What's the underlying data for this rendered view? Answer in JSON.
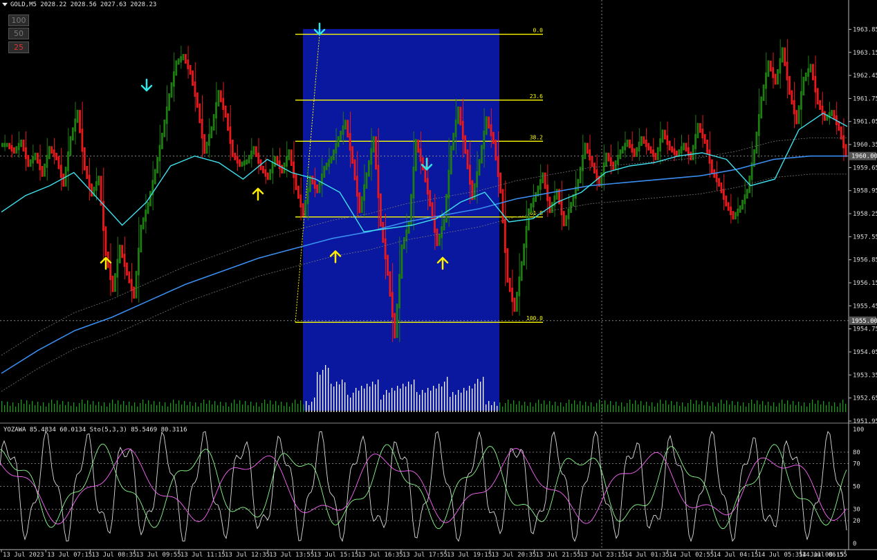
{
  "header": {
    "symbol_label": "GOLD,M5  2028.22 2028.56 2027.63 2028.23"
  },
  "zoom_buttons": [
    {
      "label": "100",
      "active": false
    },
    {
      "label": "50",
      "active": false
    },
    {
      "label": "25",
      "active": true
    }
  ],
  "indicator": {
    "label": "YOZAWA 85.4834 60.0134  Sto(5,3,3) 85.5469 80.3116"
  },
  "colors": {
    "bull": "#1e7d10",
    "bear": "#e8181c",
    "fast_ma": "#3ee0ee",
    "slow_ma": "#3a8ef0",
    "fib": "#ffff00",
    "highlight": "#0a18a0",
    "arrow_up": "#ffee00",
    "arrow_down": "#30e6e6"
  },
  "chart_data": {
    "type": "candlestick",
    "price_axis": {
      "range": [
        1951.95,
        1964.3
      ],
      "ticks": [
        "1963.85",
        "1963.15",
        "1962.45",
        "1961.75",
        "1961.05",
        "1960.35",
        "1959.65",
        "1958.95",
        "1958.25",
        "1957.55",
        "1956.85",
        "1956.15",
        "1955.45",
        "1954.75",
        "1954.05",
        "1953.35",
        "1952.65",
        "1951.95"
      ],
      "markers": [
        "1960.00",
        "1955.00"
      ]
    },
    "time_axis": {
      "ticks": [
        "13 Jul 2023",
        "13 Jul 07:15",
        "13 Jul 08:35",
        "13 Jul 09:55",
        "13 Jul 11:15",
        "13 Jul 12:35",
        "13 Jul 13:55",
        "13 Jul 15:15",
        "13 Jul 16:35",
        "13 Jul 17:55",
        "13 Jul 19:15",
        "13 Jul 20:35",
        "13 Jul 21:55",
        "13 Jul 23:15",
        "14 Jul 01:35",
        "14 Jul 02:55",
        "14 Jul 04:15",
        "14 Jul 05:35",
        "14 Jul 06:55",
        "14 Jul 08:15"
      ]
    },
    "fibonacci": [
      {
        "label": "0.0",
        "price": 1963.7
      },
      {
        "label": "23.6",
        "price": 1961.7
      },
      {
        "label": "38.2",
        "price": 1960.45
      },
      {
        "label": "61.8",
        "price": 1958.15
      },
      {
        "label": "100.0",
        "price": 1954.95
      }
    ],
    "candle_closes": [
      1960.4,
      1960.2,
      1960.5,
      1959.8,
      1960.1,
      1959.5,
      1960.3,
      1960.0,
      1959.2,
      1960.6,
      1961.4,
      1959.7,
      1958.9,
      1959.4,
      1957.1,
      1956.0,
      1957.3,
      1956.5,
      1955.8,
      1957.9,
      1958.6,
      1959.6,
      1960.7,
      1961.9,
      1962.9,
      1963.1,
      1962.6,
      1961.6,
      1960.2,
      1960.9,
      1962.0,
      1961.3,
      1960.1,
      1959.8,
      1959.9,
      1960.3,
      1959.7,
      1959.4,
      1960.0,
      1959.6,
      1960.2,
      1959.1,
      1958.3,
      1959.4,
      1959.0,
      1959.7,
      1960.0,
      1960.6,
      1961.1,
      1959.9,
      1958.4,
      1959.5,
      1960.6,
      1958.0,
      1956.5,
      1954.6,
      1957.3,
      1958.0,
      1960.5,
      1959.7,
      1958.6,
      1957.4,
      1958.1,
      1960.3,
      1961.5,
      1960.2,
      1958.8,
      1959.9,
      1961.2,
      1960.5,
      1959.0,
      1956.3,
      1955.4,
      1956.8,
      1958.4,
      1958.9,
      1959.5,
      1958.4,
      1959.0,
      1958.0,
      1958.6,
      1959.3,
      1960.4,
      1959.8,
      1959.2,
      1960.1,
      1959.7,
      1960.2,
      1960.5,
      1960.1,
      1960.6,
      1960.3,
      1960.0,
      1960.8,
      1960.3,
      1960.1,
      1960.4,
      1960.0,
      1961.0,
      1960.5,
      1959.6,
      1959.2,
      1958.6,
      1958.2,
      1958.5,
      1959.0,
      1960.2,
      1961.8,
      1962.9,
      1962.3,
      1963.3,
      1962.0,
      1961.1,
      1962.4,
      1962.8,
      1961.7,
      1961.2,
      1961.4,
      1960.9,
      1960.1
    ],
    "fast_ma": [
      1958.3,
      1958.8,
      1959.1,
      1959.5,
      1958.7,
      1957.9,
      1958.6,
      1959.7,
      1960.0,
      1959.8,
      1959.3,
      1959.9,
      1959.5,
      1959.3,
      1958.9,
      1957.7,
      1957.8,
      1957.9,
      1958.1,
      1958.6,
      1958.9,
      1958.0,
      1958.1,
      1958.6,
      1958.9,
      1959.5,
      1959.7,
      1959.8,
      1960.0,
      1960.1,
      1959.9,
      1959.1,
      1959.3,
      1960.8,
      1961.3,
      1960.9
    ],
    "slow_ma": [
      1953.4,
      1954.1,
      1954.7,
      1955.1,
      1955.6,
      1956.1,
      1956.5,
      1956.9,
      1957.2,
      1957.5,
      1957.7,
      1958.0,
      1958.2,
      1958.4,
      1958.7,
      1958.9,
      1959.1,
      1959.2,
      1959.3,
      1959.4,
      1959.6,
      1959.9,
      1960.0,
      1960.0
    ],
    "signals": [
      {
        "type": "down",
        "price": 1963.9
      },
      {
        "type": "down",
        "price": 1962.2
      },
      {
        "type": "down",
        "price": 1959.8
      },
      {
        "type": "up",
        "price": 1956.7
      },
      {
        "type": "up",
        "price": 1958.8
      },
      {
        "type": "up",
        "price": 1956.9
      },
      {
        "type": "up",
        "price": 1956.7
      }
    ],
    "oscillator": {
      "axis_ticks": [
        "100",
        "80",
        "70",
        "50",
        "30",
        "20",
        "0"
      ],
      "levels": [
        80,
        70,
        50,
        30,
        20
      ]
    }
  }
}
